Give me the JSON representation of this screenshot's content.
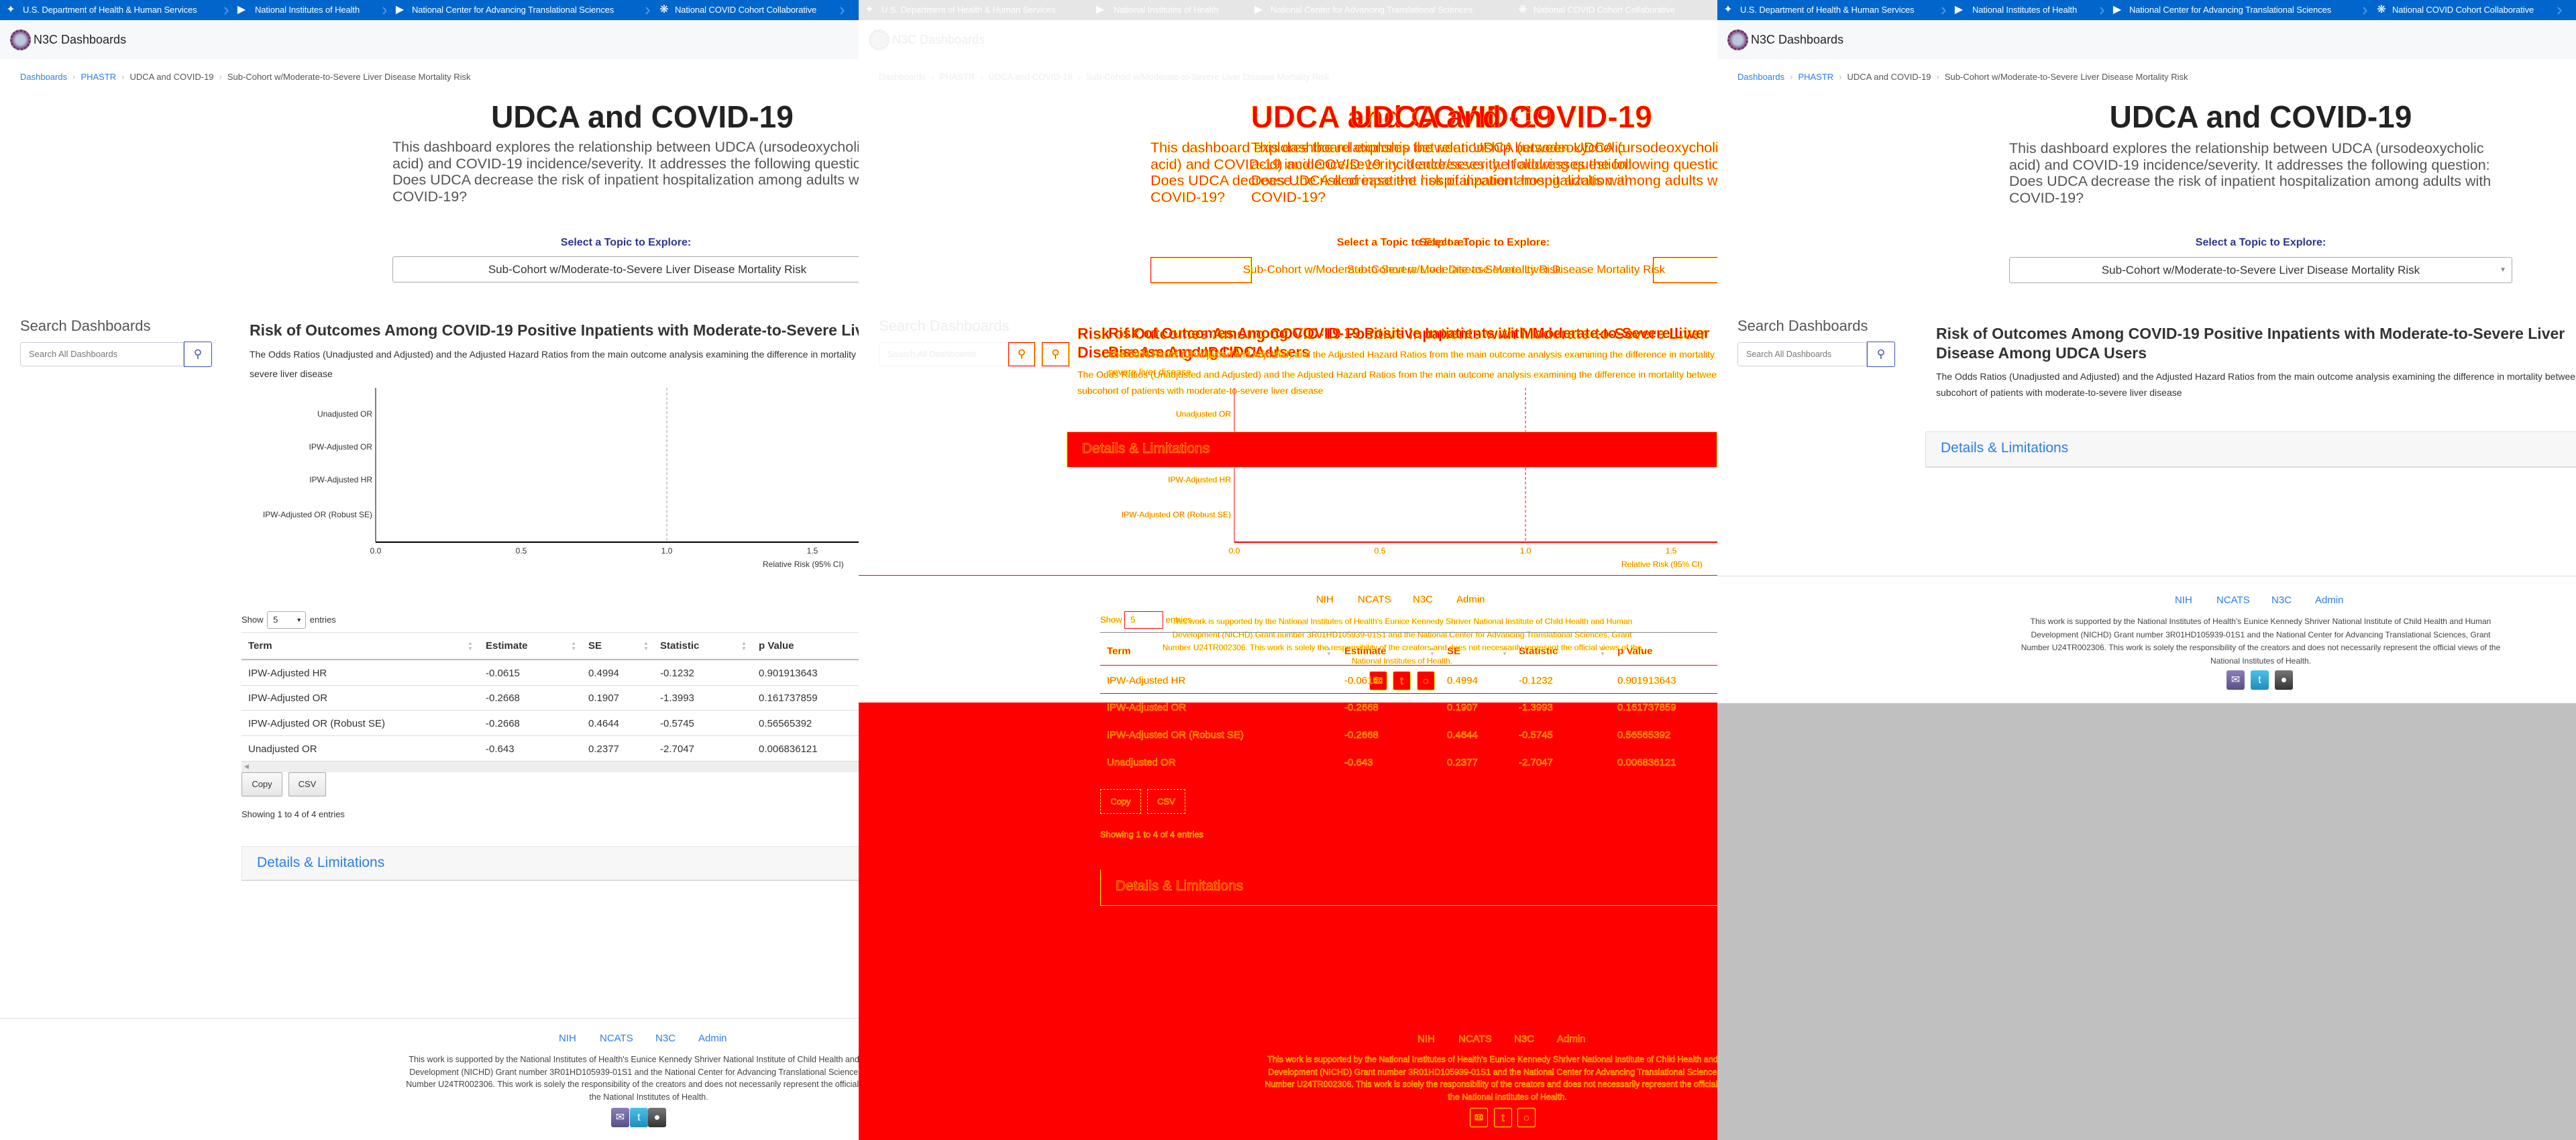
{
  "gov_bar": {
    "items": [
      {
        "label": "U.S. Department of Health & Human Services",
        "icon": "hhs-eagle-icon"
      },
      {
        "label": "National Institutes of Health",
        "icon": "nih-chevron-icon"
      },
      {
        "label": "National Center for Advancing Translational Sciences",
        "icon": "ncats-chevron-icon"
      },
      {
        "label": "National COVID Cohort Collaborative",
        "icon": "n3c-virus-icon"
      }
    ]
  },
  "header": {
    "brand": "N3C Dashboards"
  },
  "breadcrumb": [
    "Dashboards",
    "PHASTR",
    "UDCA and COVID-19",
    "Sub-Cohort w/Moderate-to-Severe Liver Disease Mortality Risk"
  ],
  "page": {
    "title": "UDCA and COVID-19",
    "description": "This dashboard explores the relationship between UDCA (ursodeoxycholic acid) and COVID-19 incidence/severity. It addresses the following question: Does UDCA decrease the risk of inpatient hospitalization among adults with COVID-19?",
    "topic_label": "Select a Topic to Explore:",
    "topic_selected": "Sub-Cohort w/Moderate-to-Severe Liver Disease Mortality Risk"
  },
  "sidebar": {
    "heading": "Search Dashboards",
    "search_placeholder": "Search All Dashboards"
  },
  "section": {
    "title": "Risk of Outcomes Among COVID-19 Positive Inpatients with Moderate-to-Severe Liver Disease Among UDCA Users",
    "subtitle": "The Odds Ratios (Unadjusted and Adjusted) and the Adjusted Hazard Ratios from the main outcome analysis examining the difference in mortality between UDCA-treated and untreated patients in the subcohort of patients with moderate-to-severe liver disease"
  },
  "chart_data": {
    "type": "scatter",
    "title": "",
    "categories": [
      "Unadjusted OR",
      "IPW-Adjusted OR",
      "IPW-Adjusted HR",
      "IPW-Adjusted OR (Robust SE)"
    ],
    "x_ticks": [
      "0.0",
      "0.5",
      "1.0",
      "1.5"
    ],
    "xlim": [
      0,
      1.5
    ],
    "reference_line": 1.0,
    "xlabel": "Relative Risk (95% CI)",
    "ylabel": "",
    "points": []
  },
  "table": {
    "show_label": "Show",
    "entries_label": "entries",
    "page_size": "5",
    "columns": [
      "Term",
      "Estimate",
      "SE",
      "Statistic",
      "p Value"
    ],
    "rows": [
      [
        "IPW-Adjusted HR",
        "-0.0615",
        "0.4994",
        "-0.1232",
        "0.901913643"
      ],
      [
        "IPW-Adjusted OR",
        "-0.2668",
        "0.1907",
        "-1.3993",
        "0.161737859"
      ],
      [
        "IPW-Adjusted OR (Robust SE)",
        "-0.2668",
        "0.4644",
        "-0.5745",
        "0.56565392"
      ],
      [
        "Unadjusted OR",
        "-0.643",
        "0.2377",
        "-2.7047",
        "0.006836121"
      ]
    ],
    "buttons": [
      "Copy",
      "CSV"
    ],
    "info": "Showing 1 to 4 of 4 entries"
  },
  "details": {
    "label": "Details & Limitations"
  },
  "footer": {
    "links": [
      "NIH",
      "NCATS",
      "N3C",
      "Admin"
    ],
    "text": "This work is supported by the National Institutes of Health's Eunice Kennedy Shriver National Institute of Child Health and Human Development (NICHD) Grant number 3R01HD105939-01S1 and the National Center for Advancing Translational Sciences, Grant Number U24TR002306. This work is solely the responsibility of the creators and does not necessarily represent the official views of the National Institutes of Health.",
    "social": [
      "email-icon",
      "twitter-icon",
      "github-icon"
    ]
  },
  "colors": {
    "gov_bar": "#0066cc",
    "link": "#2b7de9",
    "topic_label": "#2c3592",
    "diff_red": "#ff0000",
    "diff_yellow": "#ffff00"
  }
}
